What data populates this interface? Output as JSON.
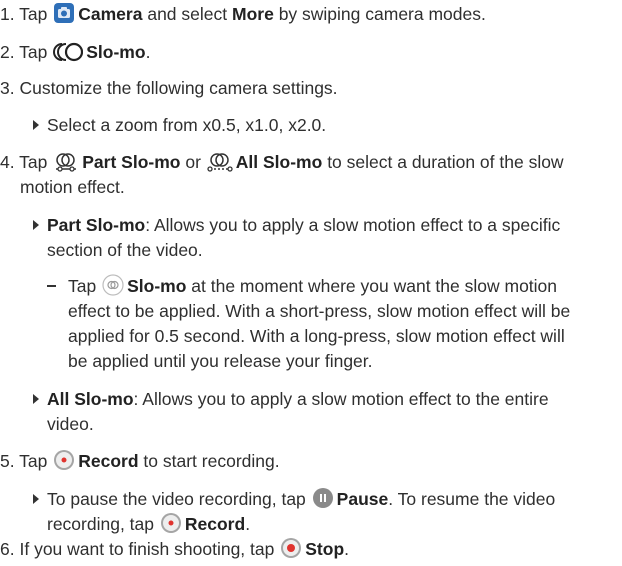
{
  "steps": [
    {
      "num": "1.",
      "pre": "Tap",
      "icon": "camera-app-icon",
      "bold1": "Camera",
      "mid": "and select",
      "bold2": "More",
      "post": "by swiping camera modes."
    },
    {
      "num": "2.",
      "pre": "Tap",
      "icon": "slo-mo-mode-icon",
      "bold1": "Slo-mo",
      "post": "."
    },
    {
      "num": "3.",
      "text": "Customize the following camera settings."
    },
    {
      "num": "4.",
      "pre": "Tap",
      "icon1": "part-slo-mo-icon",
      "bold1": "Part Slo-mo",
      "mid": "or",
      "icon2": "all-slo-mo-icon",
      "bold2": "All Slo-mo",
      "post_line1": "to select a duration of the slow",
      "post_line2": "motion effect."
    },
    {
      "num": "5.",
      "pre": "Tap",
      "icon": "record-icon",
      "bold1": "Record",
      "post": "to start recording."
    },
    {
      "num": "6.",
      "pre": "If you want to finish shooting, tap",
      "icon": "stop-icon",
      "bold1": "Stop",
      "post": "."
    }
  ],
  "bullet_zoom": "Select a zoom from x0.5, x1.0, x2.0.",
  "bullet_part": {
    "bold": "Part Slo-mo",
    "line1": ": Allows you to apply a slow motion effect to a specific",
    "line2": "section of the video."
  },
  "dash_item": {
    "pre": "Tap",
    "icon": "slo-mo-button-icon",
    "bold": "Slo-mo",
    "line1": "at the moment where you want the slow motion",
    "line2": "effect to be applied. With a short-press, slow motion effect will be",
    "line3": "applied for 0.5 second. With a long-press, slow motion effect will",
    "line4": "be applied until you release your finger."
  },
  "bullet_all": {
    "bold": "All Slo-mo",
    "line1": ": Allows you to apply a slow motion effect to the entire",
    "line2": "video."
  },
  "bullet_pause": {
    "line1_pre": "To pause the video recording, tap",
    "pause_icon": "pause-icon",
    "pause_bold": "Pause",
    "line1_post": ". To resume the video",
    "line2_pre": "recording, tap",
    "record_icon": "record-icon",
    "record_bold": "Record",
    "line2_post": "."
  },
  "colors": {
    "camera_icon": "#2e6fb8",
    "record_dot": "#e0342f",
    "pause_icon": "#8a8a8a",
    "icon_grey": "#9a9a9a"
  }
}
